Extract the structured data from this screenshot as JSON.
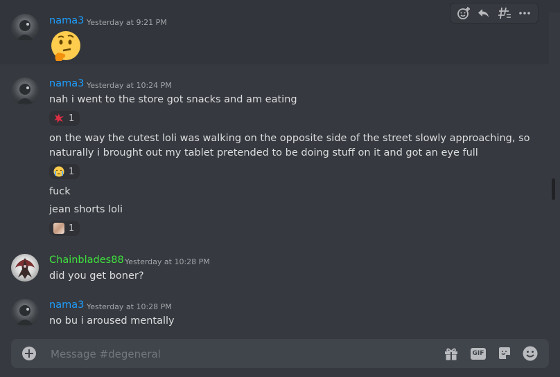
{
  "channel": {
    "input_placeholder": "Message #degeneral"
  },
  "colors": {
    "nama3": "#1e9eff",
    "chainblades": "#3ee23e",
    "background": "#36393f"
  },
  "toolbar_icons": [
    "add-reaction-icon",
    "reply-icon",
    "create-thread-icon",
    "more-icon"
  ],
  "composer_icons": [
    "gift-icon",
    "gif-icon",
    "sticker-icon",
    "emoji-icon"
  ],
  "composer": {
    "gif_label": "GIF"
  },
  "messages": [
    {
      "author": "nama3",
      "timestamp": "Yesterday at 9:21 PM",
      "content": "thinking-face-emoji"
    },
    {
      "author": "nama3",
      "timestamp": "Yesterday at 10:24 PM",
      "lines": [
        "nah i went to the store got snacks and am eating",
        "on the way the cutest loli was walking on the opposite side of the street slowly approaching, so",
        "naturally i brought out my tablet pretended to be doing stuff on it and got an eye full",
        "fuck",
        "jean shorts loli"
      ],
      "reactions": [
        {
          "emoji": "anger-emoji",
          "count": "1"
        },
        {
          "emoji": "crying-face-emoji",
          "count": "1"
        },
        {
          "emoji": "custom-image-emoji",
          "count": "1"
        }
      ]
    },
    {
      "author": "Chainblades88",
      "timestamp": "Yesterday at 10:28 PM",
      "lines": [
        "did you get boner?"
      ]
    },
    {
      "author": "nama3",
      "timestamp": "Yesterday at 10:28 PM",
      "lines": [
        "no bu i aroused mentally"
      ]
    }
  ]
}
